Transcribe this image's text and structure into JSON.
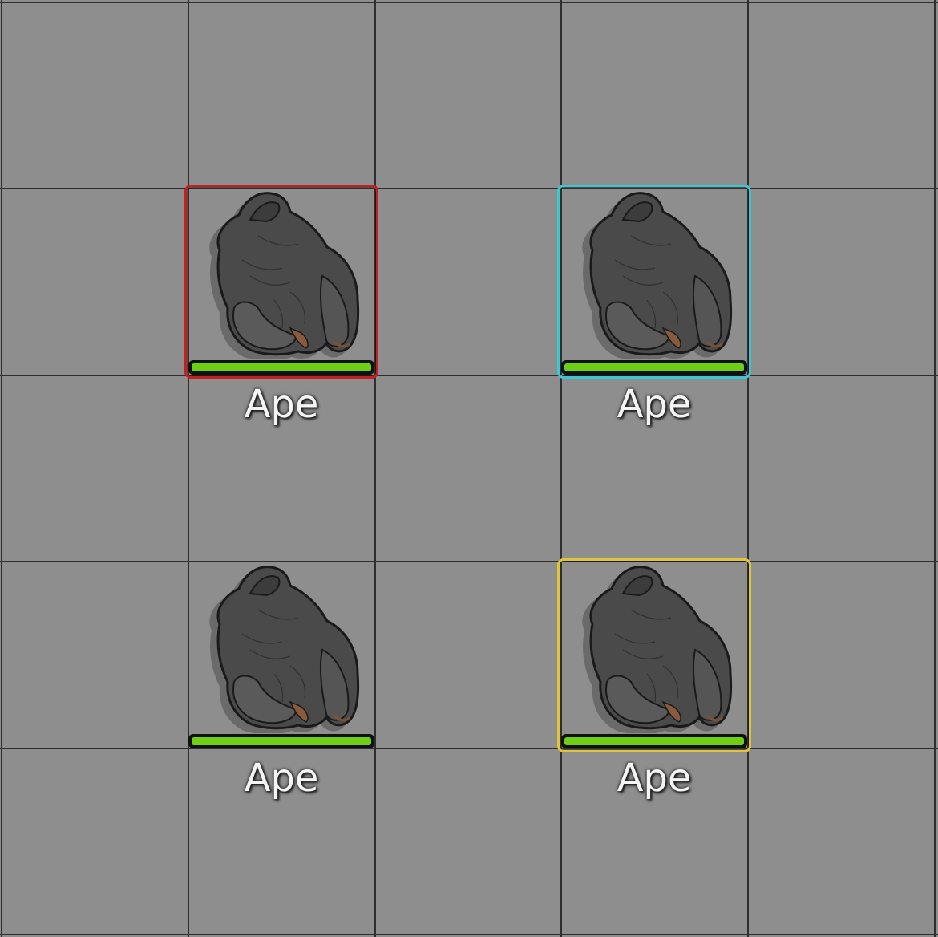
{
  "scene": {
    "background_color": "#8e8e8e",
    "grid_line_color": "#2f2f2f"
  },
  "tokens": [
    {
      "name": "Ape",
      "frame_color": "#c42020",
      "selected": true,
      "hp_fraction": 1.0,
      "hp_color": "#6fcf14",
      "icon": "gorilla-icon"
    },
    {
      "name": "Ape",
      "frame_color": "#3cc6d0",
      "selected": true,
      "hp_fraction": 1.0,
      "hp_color": "#6fcf14",
      "icon": "gorilla-icon"
    },
    {
      "name": "Ape",
      "frame_color": "",
      "selected": false,
      "hp_fraction": 1.0,
      "hp_color": "#6fcf14",
      "icon": "gorilla-icon"
    },
    {
      "name": "Ape",
      "frame_color": "#e0c43a",
      "selected": true,
      "hp_fraction": 1.0,
      "hp_color": "#6fcf14",
      "icon": "gorilla-icon"
    }
  ]
}
